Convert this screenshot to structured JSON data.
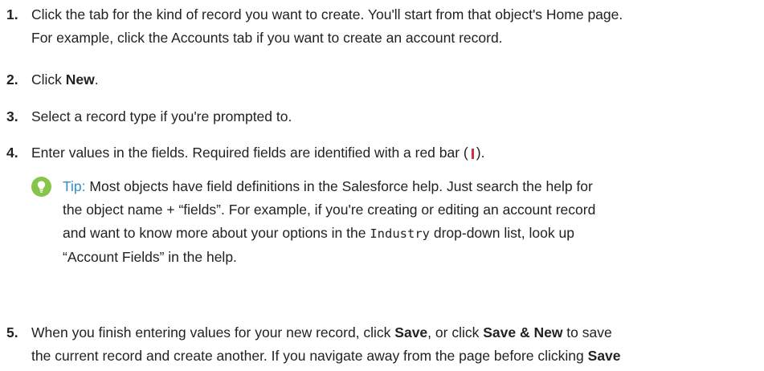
{
  "steps": [
    {
      "number": "1.",
      "line1": "Click the tab for the kind of record you want to create. You'll start from that object's Home page.",
      "line2": "For example, click the Accounts tab if you want to create an account record."
    },
    {
      "number": "2.",
      "pre": "Click ",
      "bold": "New",
      "post": "."
    },
    {
      "number": "3.",
      "text": "Select a record type if you're prompted to."
    },
    {
      "number": "4.",
      "pre": "Enter values in the fields. Required fields are identified with a red bar (",
      "post": ")."
    },
    {
      "number": "5.",
      "line1_pre": "When you finish entering values for your new record, click ",
      "line1_save": "Save",
      "line1_mid": ", or click ",
      "line1_save_new": "Save & New",
      "line1_post": " to save",
      "line2_pre": "the current record and create another. If you navigate away from the page before clicking ",
      "line2_bold": "Save"
    }
  ],
  "tip": {
    "label": "Tip:",
    "line1": " Most objects have field definitions in the Salesforce help. Just search the help for",
    "line2": "the object name + “fields”. For example, if you're creating or editing an account record",
    "line3_pre": "and want to know more about your options in the ",
    "line3_code": "Industry",
    "line3_post": " drop-down list, look up",
    "line4": "“Account Fields” in the help.",
    "icon": "lightbulb-icon"
  },
  "colors": {
    "tip_label": "#2d8ec9",
    "tip_icon_bg": "#86c44a",
    "required_bar": "#c23934",
    "text": "#222222"
  }
}
